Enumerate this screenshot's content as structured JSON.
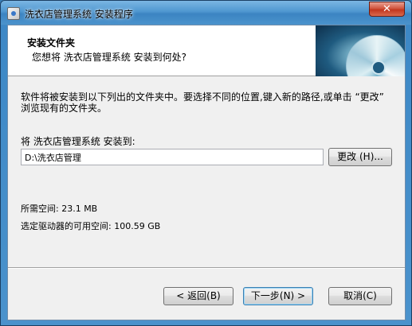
{
  "window": {
    "title": "洗衣店管理系统 安装程序",
    "close_label": "✕"
  },
  "header": {
    "title": "安装文件夹",
    "subtitle": "您想将 洗衣店管理系统 安装到何处?"
  },
  "body": {
    "description": "软件将被安装到以下列出的文件夹中。要选择不同的位置,键入新的路径,或单击 “更改” 浏览现有的文件夹。",
    "install_label": "将 洗衣店管理系统 安装到:",
    "install_path": "D:\\洗衣店管理",
    "browse_label": "更改 (H)...",
    "space_required": "所需空间: 23.1 MB",
    "space_available": "选定驱动器的可用空间: 100.59 GB"
  },
  "footer": {
    "back_label": "< 返回(B)",
    "next_label": "下一步(N) >",
    "cancel_label": "取消(C)"
  },
  "icons": {
    "app": "installer-app-icon",
    "header_image": "cd-disc-image"
  }
}
